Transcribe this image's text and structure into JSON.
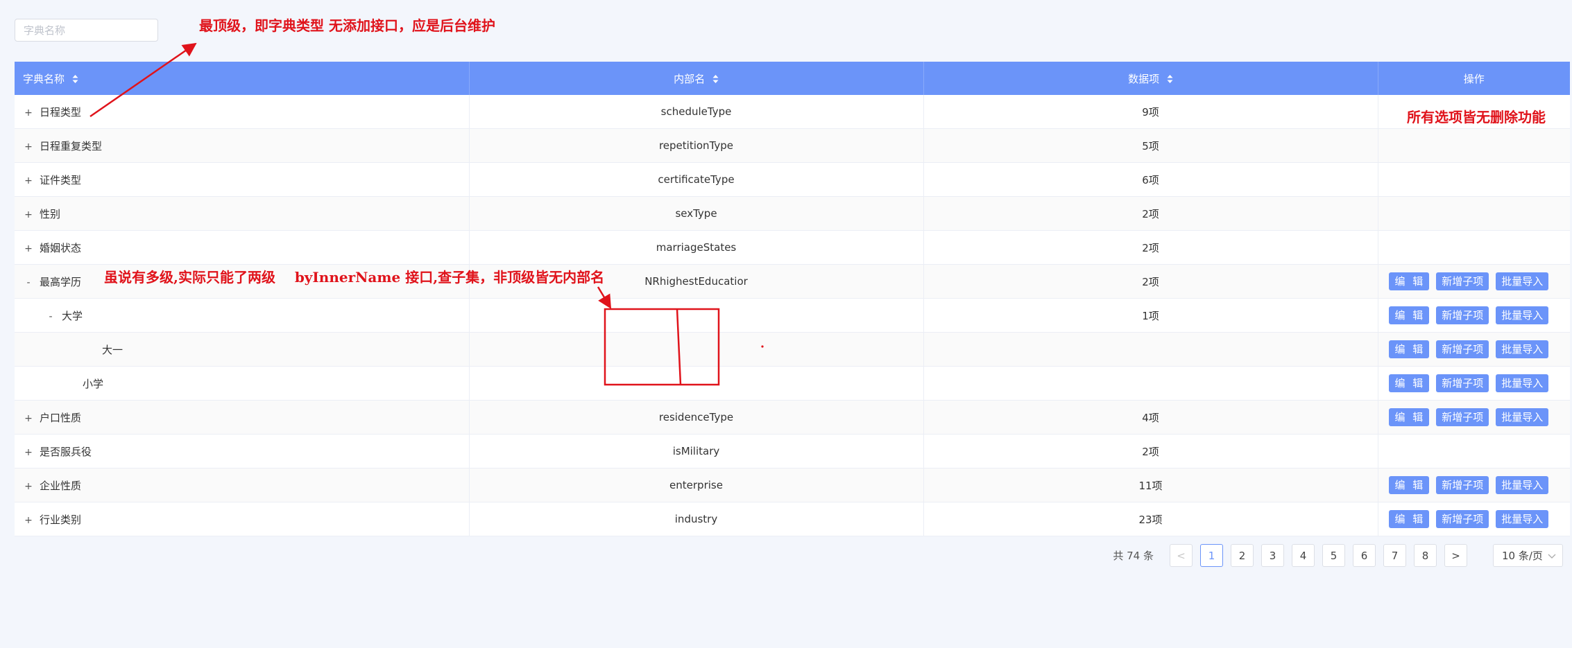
{
  "search": {
    "placeholder": "字典名称",
    "value": ""
  },
  "table": {
    "columns": [
      "字典名称",
      "内部名",
      "数据项",
      "操作"
    ],
    "rows": [
      {
        "expander": "+",
        "name": "日程类型",
        "inner": "scheduleType",
        "count": "9项",
        "actions": false
      },
      {
        "expander": "+",
        "name": "日程重复类型",
        "inner": "repetitionType",
        "count": "5项",
        "actions": false
      },
      {
        "expander": "+",
        "name": "证件类型",
        "inner": "certificateType",
        "count": "6项",
        "actions": false
      },
      {
        "expander": "+",
        "name": "性别",
        "inner": "sexType",
        "count": "2项",
        "actions": false
      },
      {
        "expander": "+",
        "name": "婚姻状态",
        "inner": "marriageStates",
        "count": "2项",
        "actions": false
      },
      {
        "expander": "-",
        "name": "最高学历",
        "inner": "NRhighestEducatior",
        "count": "2项",
        "actions": true
      },
      {
        "expander": "-",
        "name": "大学",
        "inner": "",
        "count": "1项",
        "actions": true
      },
      {
        "expander": "",
        "name": "大一",
        "inner": "",
        "count": "",
        "actions": true
      },
      {
        "expander": "",
        "name": "小学",
        "inner": "",
        "count": "",
        "actions": true
      },
      {
        "expander": "+",
        "name": "户口性质",
        "inner": "residenceType",
        "count": "4项",
        "actions": true
      },
      {
        "expander": "+",
        "name": "是否服兵役",
        "inner": "isMilitary",
        "count": "2项",
        "actions": false
      },
      {
        "expander": "+",
        "name": "企业性质",
        "inner": "enterprise",
        "count": "11项",
        "actions": true
      },
      {
        "expander": "+",
        "name": "行业类别",
        "inner": "industry",
        "count": "23项",
        "actions": true
      }
    ],
    "buttons": {
      "edit": "编 辑",
      "add_child": "新增子项",
      "import": "批量导入"
    }
  },
  "pagination": {
    "total": "共 74 条",
    "prev": "<",
    "next": ">",
    "pages": [
      "1",
      "2",
      "3",
      "4",
      "5",
      "6",
      "7",
      "8"
    ],
    "current": "1",
    "page_size": "10 条/页"
  },
  "annotations": {
    "top": "最顶级，即字典类型 无添加接口，应是后台维护",
    "right": "所有选项皆无删除功能",
    "middle": "虽说有多级,实际只能了两级    byInnerName 接口,查子集，非顶级皆无内部名"
  },
  "colors": {
    "header": "#6b94f9",
    "annotation": "#e0131b",
    "background": "#f3f6fc"
  }
}
